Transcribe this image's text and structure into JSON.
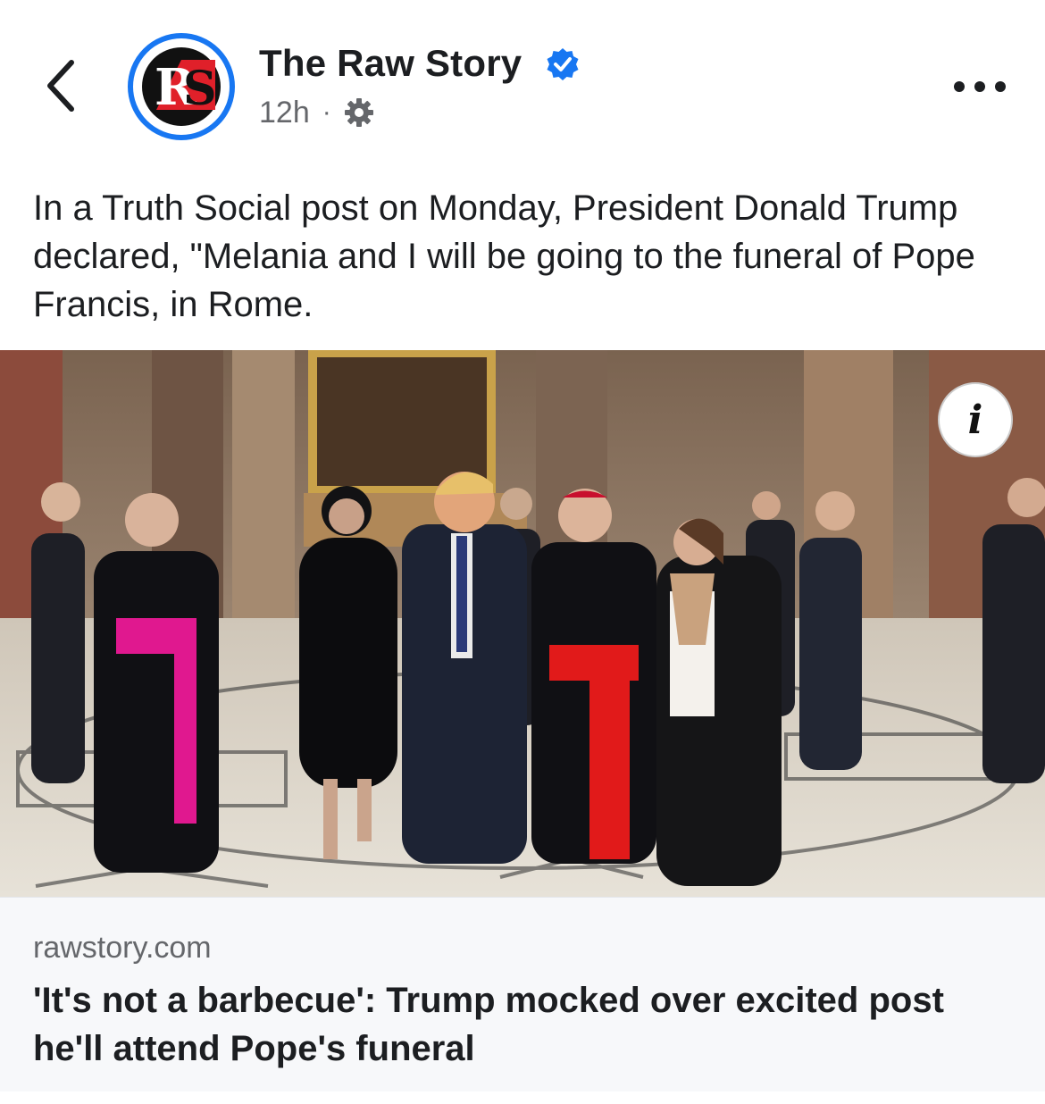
{
  "header": {
    "page_name": "The Raw Story",
    "time": "12h",
    "separator": "·",
    "back_icon": "chevron-left-icon",
    "more_icon": "more-horizontal-icon",
    "verified_icon": "verified-badge-icon",
    "audience_icon": "gear-icon",
    "avatar_text": "RS"
  },
  "post": {
    "text": "In a Truth Social post on Monday, President Donald Trump declared, \"Melania and I will be going to the funeral of Pope Francis, in Rome."
  },
  "media": {
    "info_label": "i"
  },
  "link": {
    "domain": "rawstory.com",
    "title": "'It's not a barbecue': Trump mocked over excited post he'll attend Pope's funeral"
  },
  "colors": {
    "accent": "#1877f2",
    "text_primary": "#1c1e21",
    "text_secondary": "#65676b",
    "card_bg": "#f7f8fa",
    "brand_red": "#e0202a"
  }
}
